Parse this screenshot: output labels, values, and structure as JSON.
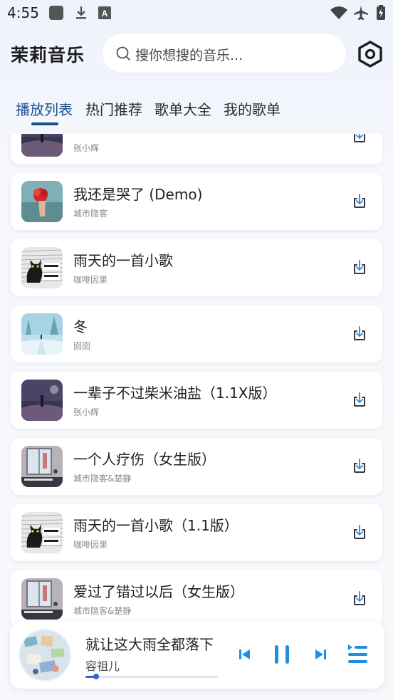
{
  "status_bar": {
    "time": "4:55",
    "icons": [
      "image-icon",
      "download-icon",
      "keyboard-icon",
      "wifi-icon",
      "airplane-icon",
      "battery-icon"
    ]
  },
  "header": {
    "app_title": "茉莉音乐",
    "search_placeholder": "搜你想搜的音乐..."
  },
  "tabs": [
    {
      "label": "播放列表",
      "active": true
    },
    {
      "label": "热门推荐",
      "active": false
    },
    {
      "label": "歌单大全",
      "active": false
    },
    {
      "label": "我的歌单",
      "active": false
    }
  ],
  "songs": [
    {
      "title": "",
      "artist": "张小辉",
      "cover": "night-road"
    },
    {
      "title": "我还是哭了 (Demo)",
      "artist": "城市隐客",
      "cover": "red-flower"
    },
    {
      "title": "雨天的一首小歌",
      "artist": "咖啡因果",
      "cover": "black-cat"
    },
    {
      "title": "冬",
      "artist": "囵囵",
      "cover": "winter-snow"
    },
    {
      "title": "一辈子不过柴米油盐（1.1X版）",
      "artist": "张小辉",
      "cover": "night-road"
    },
    {
      "title": "一个人疗伤（女生版）",
      "artist": "城市隐客&楚静",
      "cover": "window-room"
    },
    {
      "title": "雨天的一首小歌（1.1版）",
      "artist": "咖啡因果",
      "cover": "black-cat"
    },
    {
      "title": "爱过了错过以后（女生版）",
      "artist": "城市隐客&楚静",
      "cover": "window-room"
    }
  ],
  "player": {
    "title": "就让这大雨全都落下",
    "artist": "容祖儿",
    "progress": 0.08,
    "controls": [
      "previous-icon",
      "pause-icon",
      "next-icon",
      "playlist-icon"
    ]
  },
  "colors": {
    "accent": "#1a4f8c",
    "player_accent": "#1e8fe0",
    "background": "#f5f7fc"
  }
}
